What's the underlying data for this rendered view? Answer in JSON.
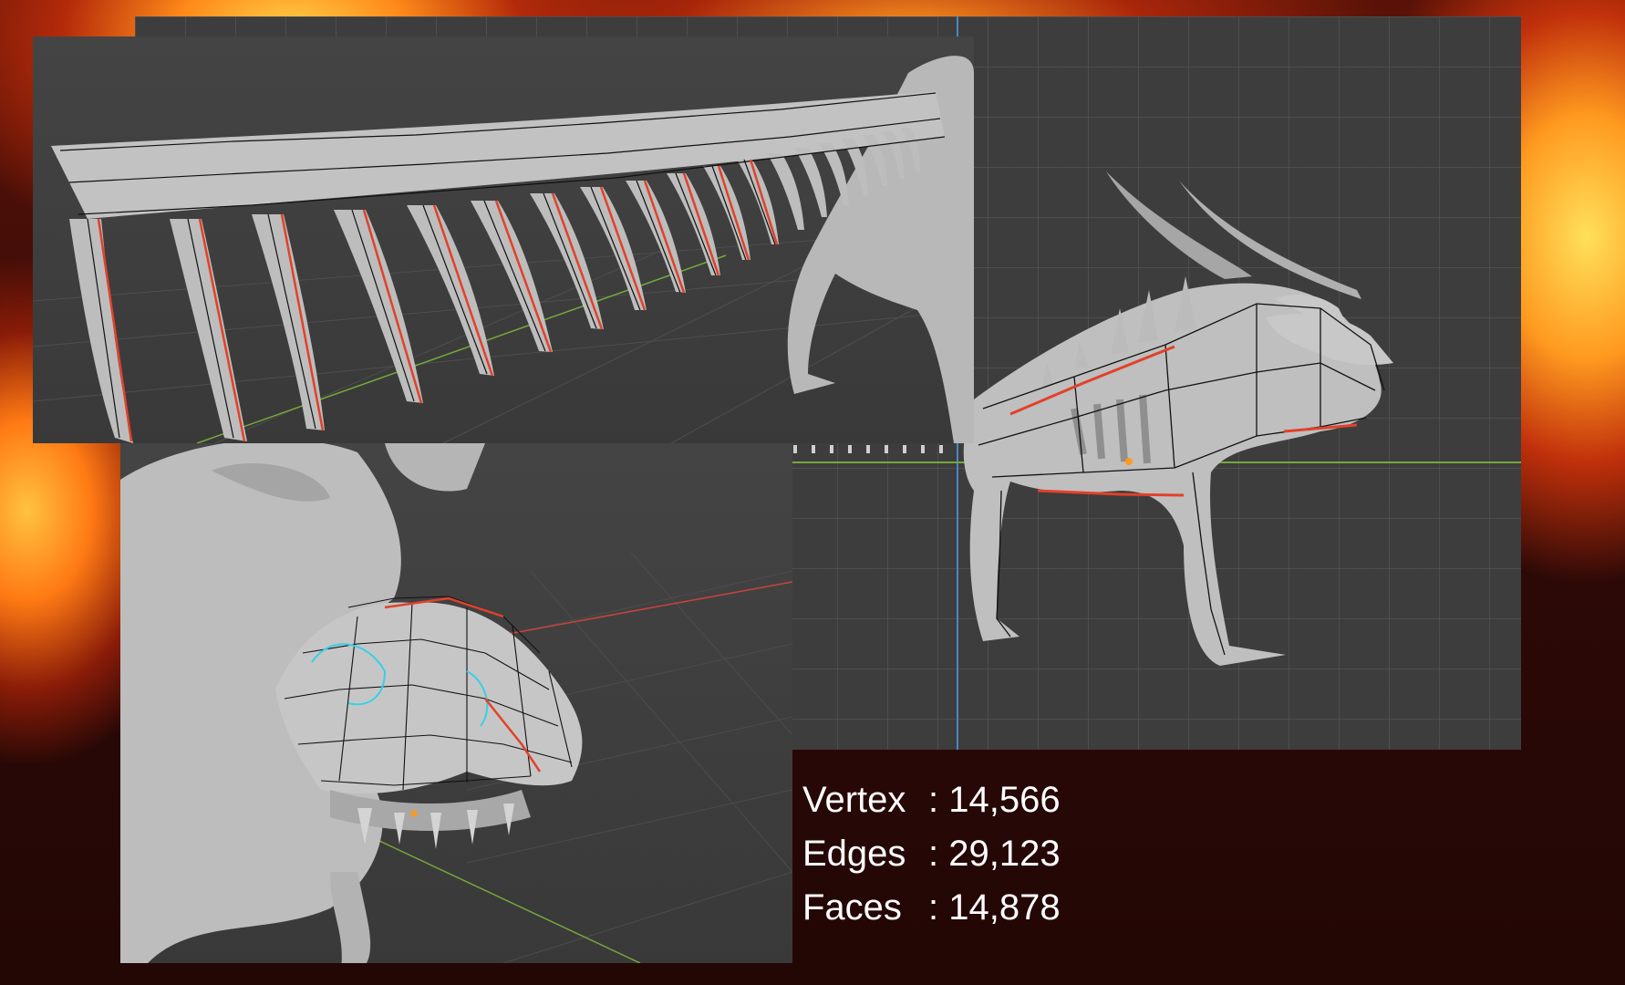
{
  "stats": {
    "vertex": {
      "label": "Vertex",
      "value": ": 14,566"
    },
    "edges": {
      "label": "Edges",
      "value": ": 29,123"
    },
    "faces": {
      "label": "Faces",
      "value": ": 14,878"
    }
  },
  "colors": {
    "viewport_bg": "#3d3d3d",
    "mesh": "#bdbdbd",
    "wire": "#111111",
    "seam": "#e2412a",
    "axis_x": "#c8443c",
    "axis_y": "#76a83a",
    "axis_z": "#4b86c6",
    "selection": "#35d0e8",
    "text": "#ffffff"
  }
}
